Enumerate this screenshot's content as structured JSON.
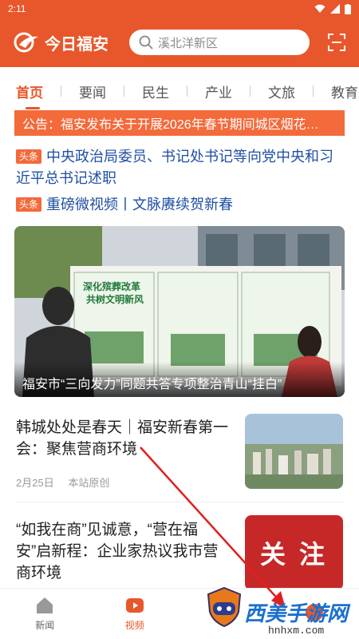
{
  "status_bar": {
    "time": "2:11"
  },
  "header": {
    "logo_text": "今日福安",
    "search_placeholder": "溪北洋新区",
    "brand_color": "#e8572b"
  },
  "tabs": [
    {
      "label": "首页",
      "active": true
    },
    {
      "label": "要闻"
    },
    {
      "label": "民生"
    },
    {
      "label": "产业"
    },
    {
      "label": "文旅"
    },
    {
      "label": "教育"
    }
  ],
  "notice": {
    "prefix": "公告：",
    "text": "福安发布关于开展2026年春节期间城区烟花…"
  },
  "headlines": [
    {
      "badge": "头条",
      "text": "中央政治局委员、书记处书记等向党中央和习近平总书记述职"
    },
    {
      "badge": "头条",
      "text": "重磅微视频丨文脉赓续贺新春"
    }
  ],
  "hero": {
    "caption": "福安市“三向发力”同题共答专项整治青山“挂白”",
    "board_text": [
      "深化殡葬改革",
      "共树文明新风"
    ]
  },
  "articles": [
    {
      "title": "韩城处处是春天｜福安新春第一会：聚焦营商环境",
      "date": "2月25日",
      "source": "本站原创"
    },
    {
      "title": "“如我在商”见诚意，“营在福安”启新程：企业家热议我市营商环境",
      "thumb_text": "关 注"
    }
  ],
  "bottom_nav": [
    {
      "label": "新闻",
      "icon": "home-icon"
    },
    {
      "label": "视频",
      "icon": "play-icon",
      "active": true
    },
    {
      "label": "",
      "icon": "gamepad-icon"
    },
    {
      "label": "",
      "icon": "mine-icon"
    }
  ],
  "watermark": {
    "text": "西美手游网",
    "url": "hnhxm.com"
  }
}
